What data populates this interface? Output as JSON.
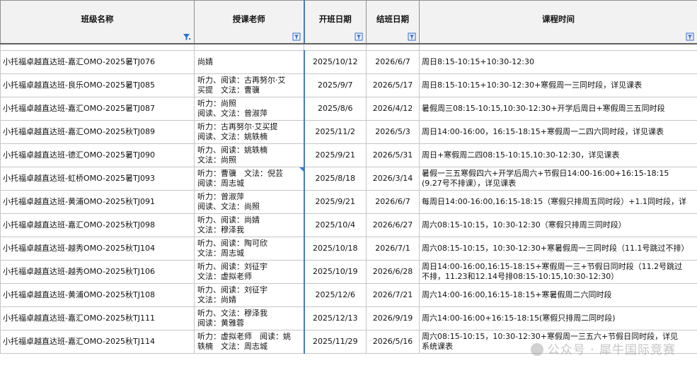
{
  "headers": {
    "class_name": "班级名称",
    "teacher": "授课老师",
    "start_date": "开班日期",
    "end_date": "结班日期",
    "schedule": "课程时间"
  },
  "rows": [
    {
      "name": "小托福卓越直达班-嘉汇OMO-2025暑TJ076",
      "teacher": "尚婧",
      "start": "2025/10/12",
      "end": "2026/6/7",
      "schedule": "周日8:15-10:15+10:30-12:30"
    },
    {
      "name": "小托福卓越直达班-良乐OMO-2025暑TJ085",
      "teacher": "听力、阅读：古再努尔·艾\n买提　文法：曹骥",
      "start": "2025/9/7",
      "end": "2026/5/17",
      "schedule": "周日8:15-10:15+10:30-12:30+寒假周一三同时段，详见课表"
    },
    {
      "name": "小托福卓越直达班-嘉汇OMO-2025暑TJ087",
      "teacher": "听力：尚照\n阅读、文法：曾淑萍",
      "start": "2025/8/6",
      "end": "2026/4/12",
      "schedule": "暑假周三08:15-10:15,10:30-12:30+开学后周日+寒假周三五同时段"
    },
    {
      "name": "小托福卓越直达班-嘉汇OMO-2025秋TJ089",
      "teacher": "听力：古再努尔·艾买提\n阅读、文法：姚轶楠",
      "start": "2025/11/2",
      "end": "2026/5/3",
      "schedule": "周日14:00-16:00，16:15-18:15+寒假周一二四六同时段，详见课表"
    },
    {
      "name": "小托福卓越直达班-德汇OMO-2025暑TJ090",
      "teacher": "听力、阅读：姚轶楠\n文法：尚照",
      "start": "2025/9/21",
      "end": "2026/5/31",
      "schedule": "周日+寒假周二四08:15-10:15,10:30-12:30，详见课表"
    },
    {
      "name": "小托福卓越直达班-虹桥OMO-2025暑TJ093",
      "teacher": "听力：曹骥　文法：倪芸\n阅读：周志城",
      "start": "2025/8/18",
      "end": "2026/3/14",
      "schedule": "暑假一三五寒假四六+开学后周六+节假日14:00-16:00+16:15-18:15\n(9.27号不排课），详见课表"
    },
    {
      "name": "小托福卓越直达班-黄浦OMO-2025秋TJ091",
      "teacher": "听力：曾淑萍\n阅读、文法：尚照",
      "start": "2025/9/21",
      "end": "2026/6/7",
      "schedule": "每周日14:00-16:00,16:15-18:15（寒假只排周五同时段）+1.1同时段，详"
    },
    {
      "name": "小托福卓越直达班-嘉汇OMO-2025秋TJ098",
      "teacher": "听力、阅读：尚婧\n文法：穆泽我",
      "start": "2025/10/4",
      "end": "2026/6/27",
      "schedule": "周六08:15-10:15，10:30-12:30（寒假只排周三同时段）"
    },
    {
      "name": "小托福卓越直达班-越秀OMO-2025秋TJ104",
      "teacher": "听力、阅读：陶可欣\n文法：周志城",
      "start": "2025/10/18",
      "end": "2026/7/1",
      "schedule": "周六08:15-10:15，10:30-12:30+寒暑假周一三同时段（11.1号跳过不排）"
    },
    {
      "name": "小托福卓越直达班-越秀OMO-2025秋TJ106",
      "teacher": "听力、阅读：刘征宇\n文法：虚拟老师",
      "start": "2025/10/19",
      "end": "2026/6/28",
      "schedule": "周日14:00-16:00,16:15-18:15+寒假周一三+节假日同时段（11.2号跳过\n不排，11.23和12.14号排08:15-10:15,10:30-12:30）"
    },
    {
      "name": "小托福卓越直达班-黄浦OMO-2025秋TJ108",
      "teacher": "听力、阅读：刘征宇\n文法：尚婧",
      "start": "2025/12/6",
      "end": "2026/7/21",
      "schedule": "周六14:00-16:00,16:15-18:15+寒暑假周二六同时段"
    },
    {
      "name": "小托福卓越直达班-嘉汇OMO-2025秋TJ111",
      "teacher": "听力、文法：穆泽我\n阅读：黄雅蓉",
      "start": "2025/12/13",
      "end": "2026/9/19",
      "schedule": "周六14:00-16:00+16:15-18:15(寒假只排周二同时段)"
    },
    {
      "name": "小托福卓越直达班-嘉汇OMO-2025秋TJ114",
      "teacher": "听力：虚拟老师　阅读：姚\n轶楠　文法：周志城",
      "start": "2025/11/29",
      "end": "2026/5/16",
      "schedule": "周六08:15-10:15，10:30-12:30+寒假周一三五六+节假日同时段，详见\n系统课表"
    }
  ],
  "watermark": "公众号 · 犀牛国际竞赛"
}
